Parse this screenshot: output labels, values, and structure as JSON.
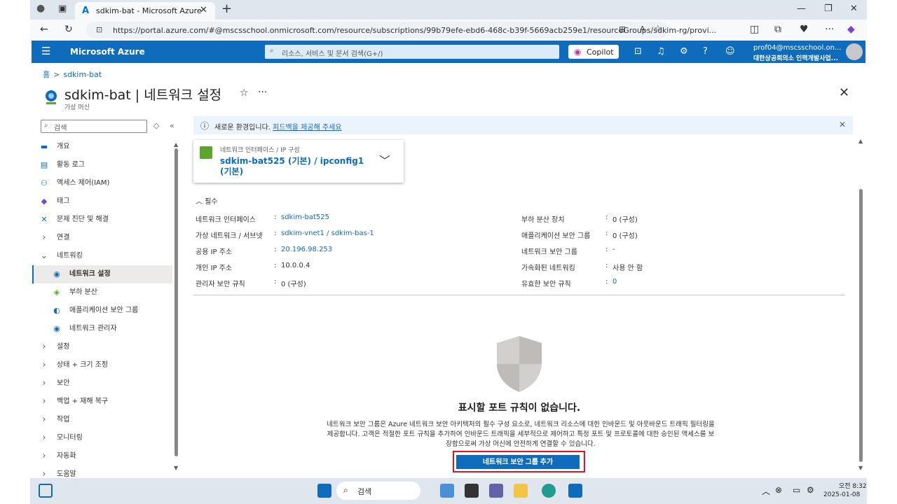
{
  "browser": {
    "tab_title": "sdkim-bat - Microsoft Azure",
    "url": "https://portal.azure.com/#@mscsschool.onmicrosoft.com/resource/subscriptions/99b79efe-ebd6-468c-b39f-5669acb259e1/resourceGroups/sdkim-rg/provi..."
  },
  "header": {
    "brand": "Microsoft Azure",
    "search_placeholder": "리소스, 서비스 및 문서 검색(G+/)",
    "copilot_label": "Copilot",
    "user_email": "prof04@mscsschool.on...",
    "user_org": "대한상공회의소 인력개발사업..."
  },
  "breadcrumb": {
    "home": "홈",
    "resource": "sdkim-bat"
  },
  "page": {
    "title": "sdkim-bat | 네트워크 설정",
    "subtitle": "가상 머신"
  },
  "nav": {
    "search_placeholder": "검색",
    "items": [
      {
        "label": "개요",
        "icon": "monitor-icon",
        "kind": "top"
      },
      {
        "label": "활동 로그",
        "icon": "log-icon",
        "kind": "top"
      },
      {
        "label": "액세스 제어(IAM)",
        "icon": "people-icon",
        "kind": "top"
      },
      {
        "label": "태그",
        "icon": "tag-icon",
        "kind": "top"
      },
      {
        "label": "문제 진단 및 해결",
        "icon": "wrench-icon",
        "kind": "top"
      },
      {
        "label": "연결",
        "icon": "chevron-right-icon",
        "kind": "group"
      },
      {
        "label": "네트워킹",
        "icon": "chevron-down-icon",
        "kind": "group"
      },
      {
        "label": "네트워크 설정",
        "icon": "network-icon",
        "kind": "child",
        "active": true
      },
      {
        "label": "부하 분산",
        "icon": "load-balancer-icon",
        "kind": "child"
      },
      {
        "label": "애플리케이션 보안 그룹",
        "icon": "shield-icon",
        "kind": "child"
      },
      {
        "label": "네트워크 관리자",
        "icon": "network-manager-icon",
        "kind": "child"
      },
      {
        "label": "설정",
        "icon": "chevron-right-icon",
        "kind": "group"
      },
      {
        "label": "상태 + 크기 조정",
        "icon": "chevron-right-icon",
        "kind": "group"
      },
      {
        "label": "보안",
        "icon": "chevron-right-icon",
        "kind": "group"
      },
      {
        "label": "백업 + 재해 복구",
        "icon": "chevron-right-icon",
        "kind": "group"
      },
      {
        "label": "작업",
        "icon": "chevron-right-icon",
        "kind": "group"
      },
      {
        "label": "모니터링",
        "icon": "chevron-right-icon",
        "kind": "group"
      },
      {
        "label": "자동화",
        "icon": "chevron-right-icon",
        "kind": "group"
      },
      {
        "label": "도움말",
        "icon": "chevron-right-icon",
        "kind": "group"
      }
    ]
  },
  "banner": {
    "text": "새로운 환경입니다.",
    "link": "피드백을 제공해 주세요"
  },
  "nic": {
    "caption": "네트워크 인터페이스 / IP 구성",
    "value": "sdkim-bat525 (기본) / ipconfig1 (기본)"
  },
  "essentials": {
    "label": "필수",
    "left": [
      {
        "key": "네트워크 인터페이스",
        "value": "sdkim-bat525",
        "link": true
      },
      {
        "key": "가상 네트워크 / 서브넷",
        "value": "sdkim-vnet1 / sdkim-bas-1",
        "link": true
      },
      {
        "key": "공용 IP 주소",
        "value": "20.196.98.253",
        "link": true
      },
      {
        "key": "개인 IP 주소",
        "value": "10.0.0.4",
        "link": false
      },
      {
        "key": "관리자 보안 규칙",
        "value": "0 (구성)",
        "link": false
      }
    ],
    "right": [
      {
        "key": "부하 분산 장치",
        "value": "0 (구성)",
        "link": false
      },
      {
        "key": "애플리케이션 보안 그룹",
        "value": "0 (구성)",
        "link": false
      },
      {
        "key": "네트워크 보안 그룹",
        "value": "-",
        "link": false
      },
      {
        "key": "가속화된 네트워킹",
        "value": "사용 안 함",
        "link": false
      },
      {
        "key": "유효한 보안 규칙",
        "value": "0",
        "link": true
      }
    ]
  },
  "empty": {
    "title": "표시할 포트 규칙이 없습니다.",
    "desc": "네트워크 보안 그룹은 Azure 네트워크 보안 아키텍처의 필수 구성 요소로, 네트워크 리소스에 대한 인바운드 및 아웃바운드 트래픽 필터링을 제공합니다. 고객은 적절한 포트 규칙을 추가하여 인바운드 트래픽을 세부적으로 제어하고 특정 포트 및 프로토콜에 대한 승인된 액세스를 보장함으로써 가상 머신에 안전하게 연결할 수 있습니다.",
    "button": "네트워크 보안 그룹 추가"
  },
  "taskbar": {
    "search_label": "검색",
    "time": "오전 8:32",
    "date": "2025-01-08"
  }
}
